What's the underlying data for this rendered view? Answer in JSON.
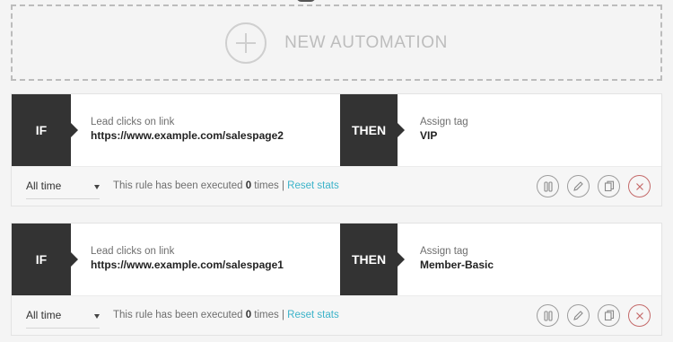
{
  "new_automation": {
    "label": "NEW AUTOMATION"
  },
  "rules": [
    {
      "if_tag": "IF",
      "trigger_label": "Lead clicks on link",
      "trigger_value": "https://www.example.com/salespage2",
      "then_tag": "THEN",
      "action_label": "Assign tag",
      "action_value": "VIP",
      "period": "All time",
      "exec_prefix": "This rule has been executed",
      "exec_count": "0",
      "exec_suffix": "times |",
      "reset_label": "Reset stats"
    },
    {
      "if_tag": "IF",
      "trigger_label": "Lead clicks on link",
      "trigger_value": "https://www.example.com/salespage1",
      "then_tag": "THEN",
      "action_label": "Assign tag",
      "action_value": "Member-Basic",
      "period": "All time",
      "exec_prefix": "This rule has been executed",
      "exec_count": "0",
      "exec_suffix": "times |",
      "reset_label": "Reset stats"
    }
  ],
  "icons": [
    "plus-circle-icon",
    "pause-icon",
    "pencil-icon",
    "copy-icon",
    "close-icon",
    "caret-down-icon"
  ],
  "colors": {
    "link": "#3cb3c9",
    "dark_block": "#333333",
    "delete": "#c46a6a"
  }
}
